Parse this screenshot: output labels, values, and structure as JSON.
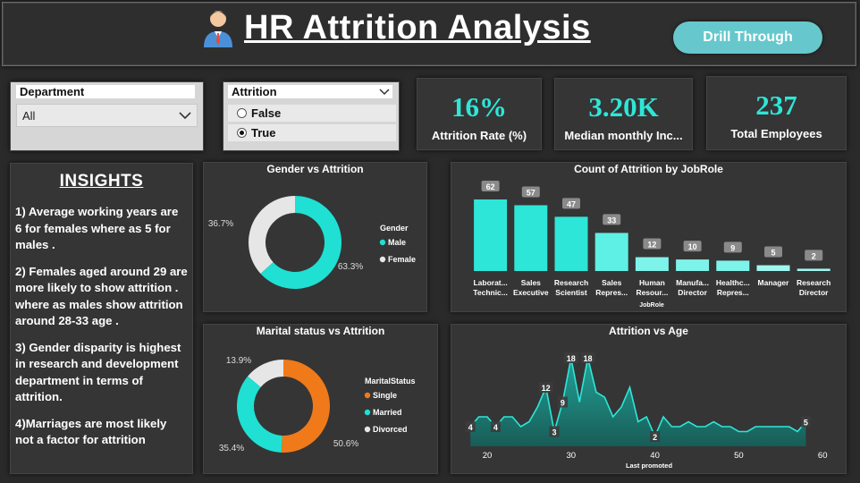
{
  "header": {
    "title": "HR Attrition Analysis",
    "drill_label": "Drill Through"
  },
  "filters": {
    "department": {
      "title": "Department",
      "value": "All"
    },
    "attrition": {
      "title": "Attrition",
      "options": [
        {
          "label": "False",
          "selected": false
        },
        {
          "label": "True",
          "selected": true
        }
      ]
    }
  },
  "kpis": [
    {
      "value": "16%",
      "label": "Attrition Rate (%)"
    },
    {
      "value": "3.20K",
      "label": "Median monthly Inc..."
    },
    {
      "value": "237",
      "label": "Total Employees"
    }
  ],
  "insights": {
    "heading": "INSIGHTS",
    "points": [
      "1) Average working years are 6 for females where as 5 for males .",
      "2) Females aged around 29 are more likely to show attrition . where as males show attrition around 28-33 age .",
      "3) Gender disparity is highest in  research and development department in terms of attrition.",
      "4)Marriages are most likely not a factor for attrition"
    ]
  },
  "colors": {
    "accent": "#2ee6d8",
    "teal": "#1fe0d2",
    "orange": "#f07a1a",
    "light": "#e6e6e6"
  },
  "chart_data": [
    {
      "type": "pie",
      "title": "Gender vs Attrition",
      "legend_title": "Gender",
      "legend_position": "right",
      "labels": [
        "Male",
        "Female"
      ],
      "values": [
        63.3,
        36.7
      ],
      "value_labels": [
        "63.3%",
        "36.7%"
      ],
      "colors": [
        "#1fe0d2",
        "#e6e6e6"
      ]
    },
    {
      "type": "bar",
      "title": "Count of Attrition by JobRole",
      "xlabel": "JobRole",
      "categories": [
        "Laborat... Technic...",
        "Sales Executive",
        "Research Scientist",
        "Sales Repres...",
        "Human Resour...",
        "Manufa... Director",
        "Healthc... Repres...",
        "Manager",
        "Research Director"
      ],
      "category_lines": [
        [
          "Laborat...",
          "Technic..."
        ],
        [
          "Sales",
          "Executive"
        ],
        [
          "Research",
          "Scientist"
        ],
        [
          "Sales",
          "Repres..."
        ],
        [
          "Human",
          "Resour..."
        ],
        [
          "Manufa...",
          "Director"
        ],
        [
          "Healthc...",
          "Repres..."
        ],
        [
          "Manager"
        ],
        [
          "Research",
          "Director"
        ]
      ],
      "values": [
        62,
        57,
        47,
        33,
        12,
        10,
        9,
        5,
        2
      ],
      "colors": [
        "#2ee6d8",
        "#2ee6d8",
        "#2ee6d8",
        "#5ef0e4",
        "#7ef3ea",
        "#7ef3ea",
        "#7ef3ea",
        "#9ff6ef",
        "#9ff6ef"
      ]
    },
    {
      "type": "pie",
      "title": "Marital status vs Attrition",
      "legend_title": "MaritalStatus",
      "legend_position": "right",
      "labels": [
        "Single",
        "Married",
        "Divorced"
      ],
      "values": [
        50.6,
        35.4,
        13.9
      ],
      "value_labels": [
        "50.6%",
        "35.4%",
        "13.9%"
      ],
      "colors": [
        "#f07a1a",
        "#1fe0d2",
        "#e6e6e6"
      ]
    },
    {
      "type": "area",
      "title": "Attrition vs Age",
      "xlabel": "Last promoted",
      "xlim": [
        17,
        60
      ],
      "ylim": [
        0,
        20
      ],
      "x_ticks": [
        20,
        30,
        40,
        50,
        60
      ],
      "x": [
        18,
        19,
        20,
        21,
        22,
        23,
        24,
        25,
        26,
        27,
        28,
        29,
        30,
        31,
        32,
        33,
        34,
        35,
        36,
        37,
        38,
        39,
        40,
        41,
        42,
        43,
        44,
        45,
        46,
        47,
        48,
        49,
        50,
        51,
        52,
        53,
        54,
        55,
        56,
        57,
        58
      ],
      "y": [
        4,
        6,
        6,
        4,
        6,
        6,
        4,
        5,
        8,
        12,
        3,
        9,
        18,
        9,
        18,
        11,
        10,
        6,
        8,
        12,
        5,
        6,
        2,
        6,
        4,
        4,
        5,
        4,
        4,
        5,
        4,
        4,
        3,
        3,
        4,
        4,
        4,
        4,
        4,
        3,
        5
      ],
      "point_labels": [
        {
          "x": 18,
          "y": 4,
          "text": "4"
        },
        {
          "x": 21,
          "y": 4,
          "text": "4"
        },
        {
          "x": 27,
          "y": 12,
          "text": "12"
        },
        {
          "x": 28,
          "y": 3,
          "text": "3"
        },
        {
          "x": 29,
          "y": 9,
          "text": "9"
        },
        {
          "x": 30,
          "y": 18,
          "text": "18"
        },
        {
          "x": 32,
          "y": 18,
          "text": "18"
        },
        {
          "x": 40,
          "y": 2,
          "text": "2"
        },
        {
          "x": 58,
          "y": 5,
          "text": "5"
        }
      ]
    }
  ]
}
